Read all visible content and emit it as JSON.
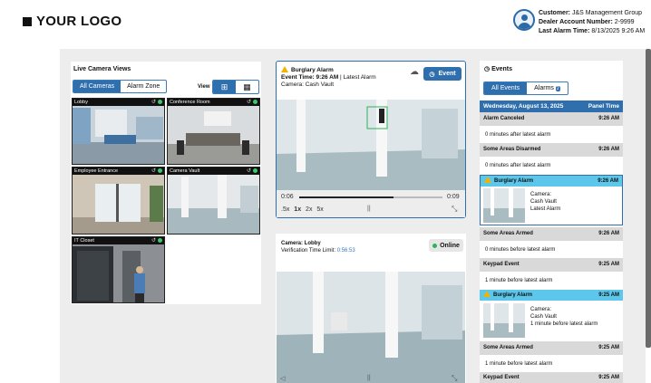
{
  "header": {
    "logo_text": "YOUR LOGO",
    "customer_label": "Customer:",
    "customer": "J&S Management Group",
    "dealer_label": "Dealer Account Number:",
    "dealer": "2-9999",
    "alarm_time_label": "Last Alarm Time:",
    "alarm_time": "8/13/2025 9:26 AM"
  },
  "live": {
    "title": "Live Camera Views",
    "tabs": [
      "All Cameras",
      "Alarm Zone"
    ],
    "view_label": "View",
    "cameras": [
      {
        "name": "Lobby"
      },
      {
        "name": "Conference Room"
      },
      {
        "name": "Employee Entrance"
      },
      {
        "name": "Camera Vault"
      },
      {
        "name": "IT Closet"
      }
    ]
  },
  "alarm_video": {
    "title": "Burglary Alarm",
    "event_time_label": "Event Time:",
    "event_time": "9:26 AM",
    "latest": "| Latest Alarm",
    "camera": "Camera: Cash Vault",
    "event_button": "Event",
    "time_start": "0:06",
    "time_end": "0:09",
    "progress": 0.66,
    "speeds": [
      ".5x",
      "1x",
      "2x",
      "5x"
    ]
  },
  "live_video": {
    "camera": "Camera: Lobby",
    "limit_label": "Verification Time Limit:",
    "limit": "0:56:53",
    "status": "Online"
  },
  "events": {
    "title": "Events",
    "tabs": [
      "All Events",
      "Alarms"
    ],
    "alarms_badge": "2",
    "date": "Wednesday, August 13, 2025",
    "panel_time": "Panel Time",
    "items": [
      {
        "title": "Alarm Canceled",
        "time": "9:26 AM",
        "detail": "0 minutes after latest alarm"
      },
      {
        "title": "Some Areas Disarmed",
        "time": "9:26 AM",
        "detail": "0 minutes after latest alarm"
      },
      {
        "title": "Burglary Alarm",
        "time": "9:26 AM",
        "cam": "Camera:",
        "cam_name": "Cash Vault",
        "note": "Latest Alarm"
      },
      {
        "title": "Some Areas Armed",
        "time": "9:26 AM",
        "detail": "0 minutes before latest alarm"
      },
      {
        "title": "Keypad Event",
        "time": "9:25 AM",
        "detail": "1 minute before latest alarm"
      },
      {
        "title": "Burglary Alarm",
        "time": "9:25 AM",
        "cam": "Camera:",
        "cam_name": "Cash Vault",
        "note": "1 minute before latest alarm"
      },
      {
        "title": "Some Areas Armed",
        "time": "9:25 AM",
        "detail": "1 minute before latest alarm"
      },
      {
        "title": "Keypad Event",
        "time": "9:25 AM"
      }
    ]
  },
  "colors": {
    "accent": "#2f6fae",
    "alarm": "#5cc7ea",
    "online": "#2db35a",
    "warning": "#f0b400"
  }
}
